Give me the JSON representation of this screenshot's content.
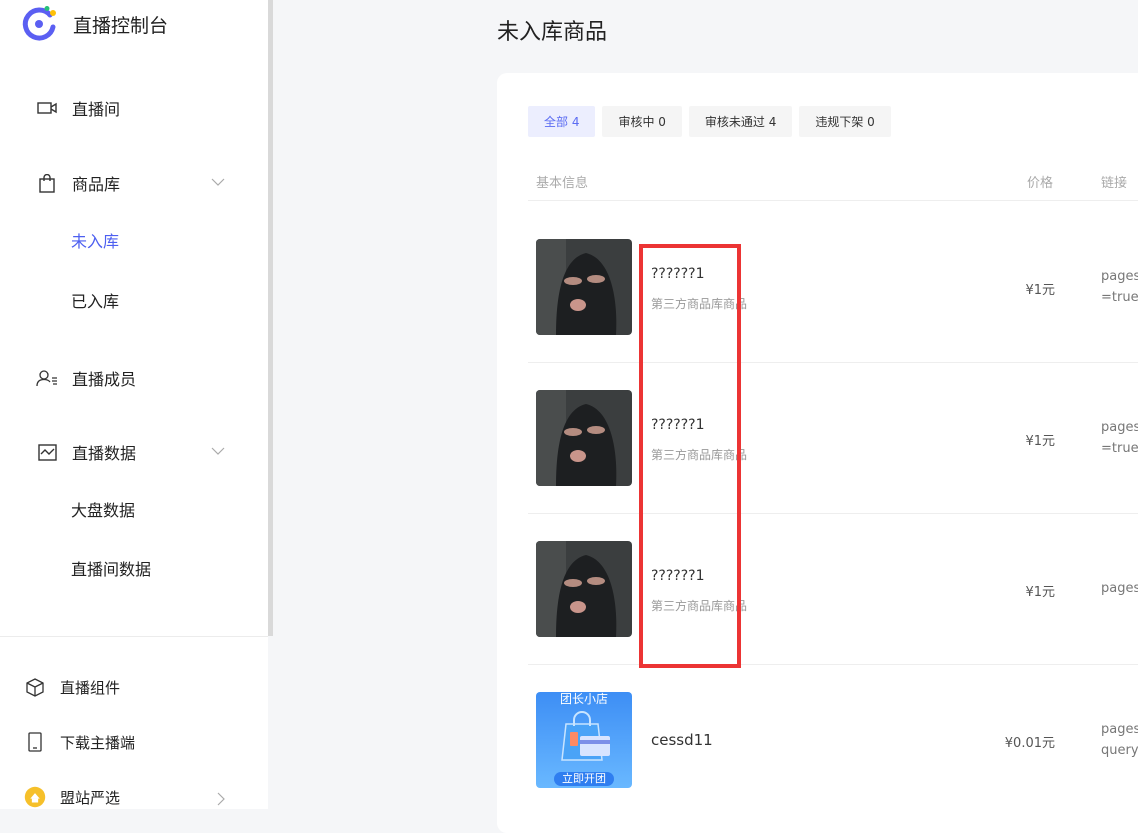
{
  "app": {
    "title": "直播控制台"
  },
  "sidebar": {
    "items": [
      {
        "label": "直播间",
        "icon": "video-camera-icon"
      },
      {
        "label": "商品库",
        "icon": "shopping-bag-icon"
      },
      {
        "label": "未入库"
      },
      {
        "label": "已入库"
      },
      {
        "label": "直播成员",
        "icon": "member-icon"
      },
      {
        "label": "直播数据",
        "icon": "chart-icon"
      },
      {
        "label": "大盘数据"
      },
      {
        "label": "直播间数据"
      }
    ],
    "active": "未入库",
    "footer": [
      {
        "label": "直播组件",
        "icon": "cube-icon"
      },
      {
        "label": "下载主播端",
        "icon": "phone-icon"
      },
      {
        "label": "盟站严选",
        "icon": "store-badge-icon"
      }
    ]
  },
  "main": {
    "title": "未入库商品",
    "tabs": [
      {
        "label": "全部 4",
        "active": true
      },
      {
        "label": "审核中 0"
      },
      {
        "label": "审核未通过 4"
      },
      {
        "label": "违规下架 0"
      }
    ],
    "columns": {
      "info": "基本信息",
      "price": "价格",
      "link": "链接"
    },
    "rows": [
      {
        "name": "??????1",
        "sub": "第三方商品库商品",
        "price": "¥1元",
        "link1": "pages",
        "link2": "=true"
      },
      {
        "name": "??????1",
        "sub": "第三方商品库商品",
        "price": "¥1元",
        "link1": "pages",
        "link2": "=true"
      },
      {
        "name": "??????1",
        "sub": "第三方商品库商品",
        "price": "¥1元",
        "link1": "pages",
        "link2": ""
      },
      {
        "name": "cessd11",
        "sub": "",
        "price": "¥0.01元",
        "link1": "pages",
        "link2": "query",
        "thumb_top": "团长小店",
        "thumb_btn": "立即开团"
      }
    ]
  },
  "colors": {
    "accent": "#4d5ff0",
    "highlight": "#ec3434"
  }
}
